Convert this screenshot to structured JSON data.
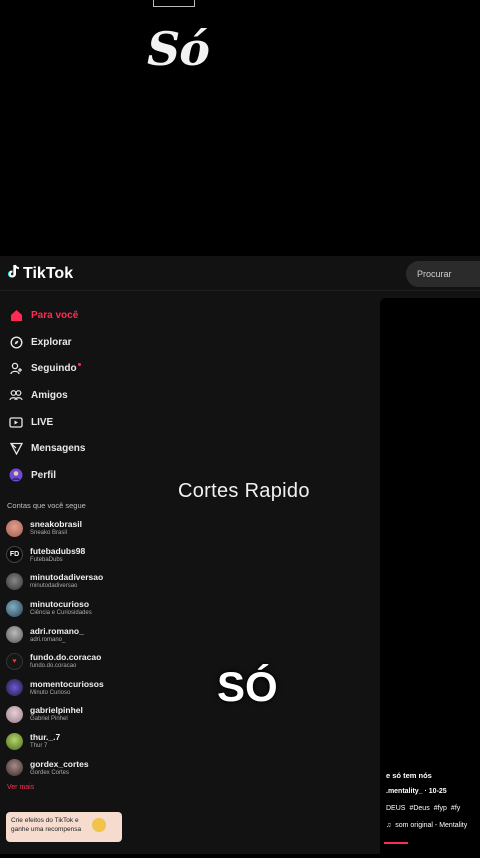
{
  "top": {
    "label": "Só"
  },
  "header": {
    "brand": "TikTok",
    "search_placeholder": "Procurar"
  },
  "nav": [
    {
      "label": "Para você",
      "icon": "home-icon",
      "active": true
    },
    {
      "label": "Explorar",
      "icon": "compass-icon"
    },
    {
      "label": "Seguindo",
      "icon": "following-icon"
    },
    {
      "label": "Amigos",
      "icon": "friends-icon"
    },
    {
      "label": "LIVE",
      "icon": "live-icon"
    },
    {
      "label": "Mensagens",
      "icon": "messages-icon"
    },
    {
      "label": "Perfil",
      "icon": "profile-avatar-icon"
    }
  ],
  "following": {
    "title": "Contas que você segue",
    "accounts": [
      {
        "name": "sneakobrasil",
        "sub": "Sneako Brasil"
      },
      {
        "name": "futebadubs98",
        "sub": "FutebaDubs"
      },
      {
        "name": "minutodadiversao",
        "sub": "minutodadiversao"
      },
      {
        "name": "minutocurioso",
        "sub": "Ciência e Curiosidades"
      },
      {
        "name": "adri.romano_",
        "sub": "adri.romano_"
      },
      {
        "name": "fundo.do.coracao",
        "sub": "fundo.do.coracao"
      },
      {
        "name": "momentocuriosos",
        "sub": "Minuto Curioso"
      },
      {
        "name": "gabrielpinhel",
        "sub": "Gabriel Pinhel"
      },
      {
        "name": "thur._.7",
        "sub": "Thur 7"
      },
      {
        "name": "gordex_cortes",
        "sub": "Gordex Cortes"
      }
    ],
    "see_more": "Ver mais"
  },
  "promo": {
    "text": "Crie efeitos do TikTok e ganhe uma recompensa"
  },
  "video": {
    "caption": "e só tem nós",
    "author_line": ".mentality_ · 10-25",
    "tags": [
      "DEUS",
      "#Deus",
      "#fyp",
      "#fy"
    ],
    "sound": "som original - Mentality"
  },
  "overlay": {
    "title": "Cortes Rapido",
    "big_text": "SÓ"
  },
  "colors": {
    "accent": "#fe2c55",
    "sidebar_bg": "#121212"
  }
}
